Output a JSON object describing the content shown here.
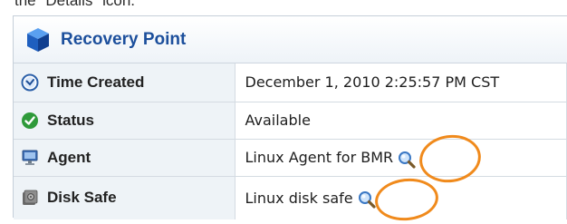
{
  "caption": "the \"Details\" icon.",
  "panel": {
    "title": "Recovery Point",
    "icon": "blue-cube-icon"
  },
  "rows": [
    {
      "label": "Time Created",
      "value": "December 1, 2010 2:25:57 PM CST",
      "icon": "clock-icon",
      "details_icon": false
    },
    {
      "label": "Status",
      "value": "Available",
      "icon": "green-check-icon",
      "details_icon": false
    },
    {
      "label": "Agent",
      "value": "Linux Agent for BMR",
      "icon": "computer-icon",
      "details_icon": true
    },
    {
      "label": "Disk Safe",
      "value": "Linux disk safe",
      "icon": "disk-safe-icon",
      "details_icon": true
    }
  ],
  "colors": {
    "title": "#1c4f9c",
    "highlight_ring": "#f08a1c",
    "label_bg": "#eef3f7"
  }
}
